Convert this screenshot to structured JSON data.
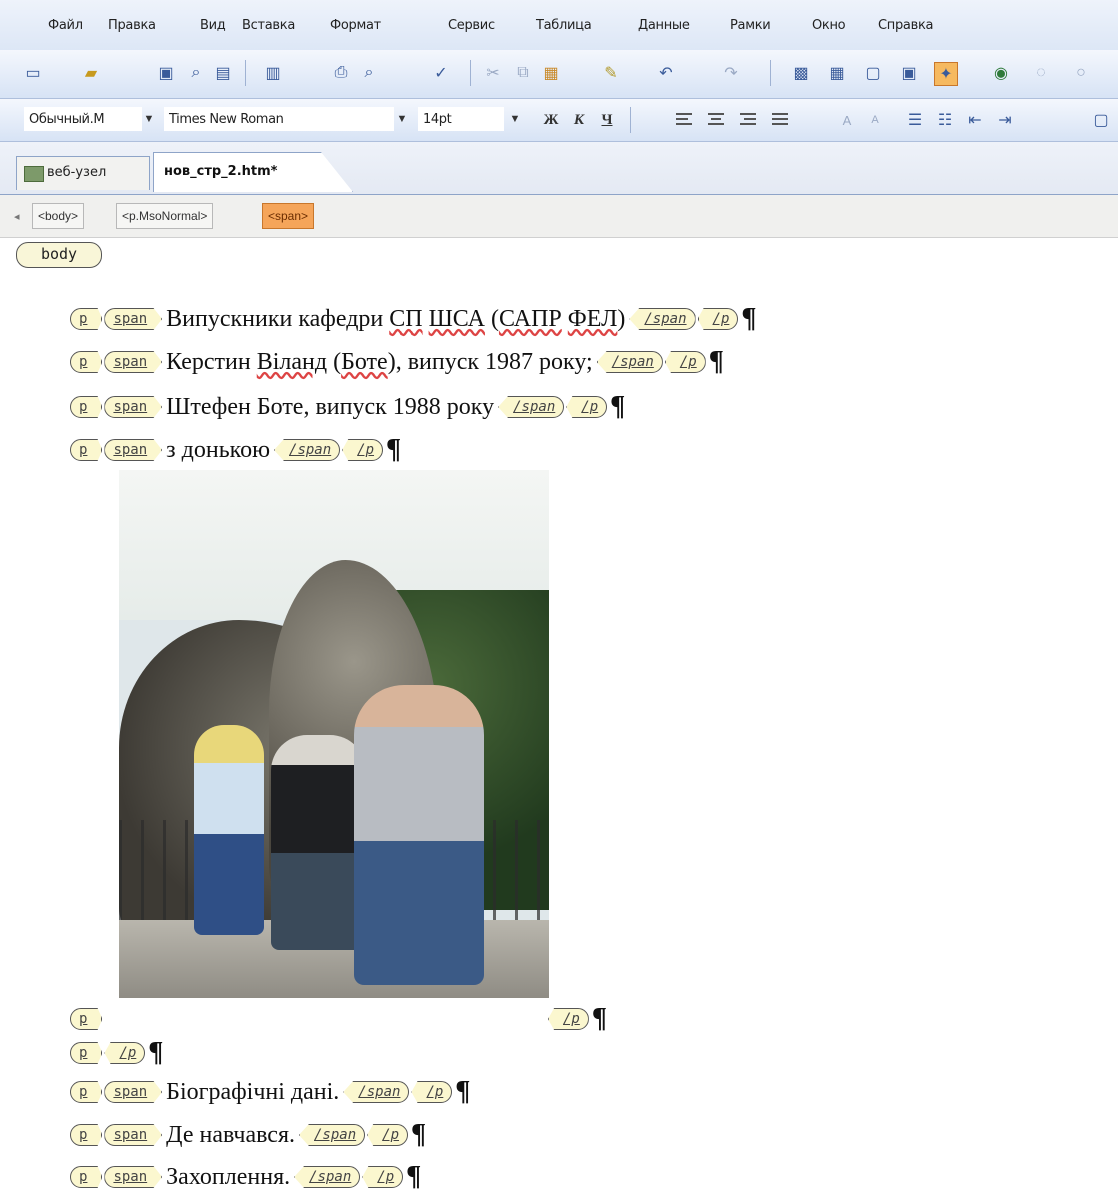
{
  "menu": {
    "items": [
      "Файл",
      "Правка",
      "Вид",
      "Вставка",
      "Формат",
      "Сервис",
      "Таблица",
      "Данные",
      "Рамки",
      "Окно",
      "Справка"
    ]
  },
  "toolbar_format": {
    "style": "Обычный.М",
    "font": "Times New Roman",
    "size": "14pt",
    "bold": "Ж",
    "italic": "К",
    "underline": "Ч"
  },
  "tabs": {
    "site": "веб-узел",
    "file": "нов_стр_2.htm*"
  },
  "tag_selector": [
    "<body>",
    "<p.MsoNormal>",
    "<span>"
  ],
  "body_tag": "body",
  "tags": {
    "p": "p",
    "span": "span",
    "p_close": "/p",
    "span_close": "/span"
  },
  "content": {
    "line1_a": "Випускники кафедри ",
    "line1_sp1": "СП",
    "line1_sp2": "ШСА",
    "line1_b": " (",
    "line1_sp3": "САПР",
    "line1_sp4": "ФЕЛ",
    "line1_c": ")",
    "line2_a": "Керстин ",
    "line2_sp1": "Віланд",
    "line2_b": " (",
    "line2_sp2": "Боте",
    "line2_c": "), випуск 1987 року;",
    "line3": "Штефен Боте, випуск 1988 року",
    "line4": "з донькою",
    "line7": "Біографічні дані.",
    "line8": "Де навчався.",
    "line9": "Захоплення."
  },
  "pilcrow": "¶"
}
